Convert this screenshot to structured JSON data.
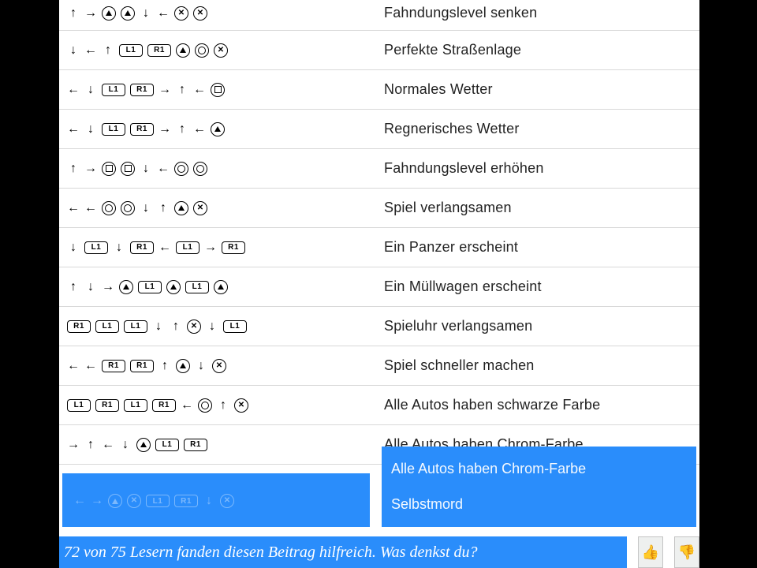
{
  "rows": [
    {
      "code": [
        "up",
        "right",
        "triangle",
        "triangle",
        "down",
        "left",
        "cross",
        "cross"
      ],
      "desc": "Fahndungslevel senken"
    },
    {
      "code": [
        "down",
        "left",
        "up",
        "L1",
        "R1",
        "triangle",
        "circle",
        "cross"
      ],
      "desc": "Perfekte Straßenlage"
    },
    {
      "code": [
        "left",
        "down",
        "L1",
        "R1",
        "right",
        "up",
        "left",
        "square"
      ],
      "desc": "Normales Wetter"
    },
    {
      "code": [
        "left",
        "down",
        "L1",
        "R1",
        "right",
        "up",
        "left",
        "triangle"
      ],
      "desc": "Regnerisches Wetter"
    },
    {
      "code": [
        "up",
        "right",
        "square",
        "square",
        "down",
        "left",
        "circle",
        "circle"
      ],
      "desc": "Fahndungslevel erhöhen"
    },
    {
      "code": [
        "left",
        "left",
        "circle",
        "circle",
        "down",
        "up",
        "triangle",
        "cross"
      ],
      "desc": "Spiel verlangsamen"
    },
    {
      "code": [
        "down",
        "L1",
        "down",
        "R1",
        "left",
        "L1",
        "right",
        "R1"
      ],
      "desc": "Ein Panzer erscheint"
    },
    {
      "code": [
        "up",
        "down",
        "right",
        "triangle",
        "L1",
        "triangle",
        "L1",
        "triangle"
      ],
      "desc": "Ein Müllwagen erscheint"
    },
    {
      "code": [
        "R1",
        "L1",
        "L1",
        "down",
        "up",
        "cross",
        "down",
        "L1"
      ],
      "desc": "Spieluhr verlangsamen"
    },
    {
      "code": [
        "left",
        "left",
        "R1",
        "R1",
        "up",
        "triangle",
        "down",
        "cross"
      ],
      "desc": "Spiel schneller machen"
    },
    {
      "code": [
        "L1",
        "R1",
        "L1",
        "R1",
        "left",
        "circle",
        "up",
        "cross"
      ],
      "desc": "Alle Autos haben schwarze Farbe"
    },
    {
      "code": [
        "right",
        "up",
        "left",
        "down",
        "triangle",
        "L1",
        "R1"
      ],
      "desc": "Alle Autos haben Chrom-Farbe"
    }
  ],
  "highlight_extra_codes": [
    "left",
    "right",
    "triangle",
    "cross",
    "L1",
    "R1",
    "down",
    "cross"
  ],
  "highlight_texts": {
    "chrome": "Alle Autos haben Chrom-Farbe",
    "suicide": "Selbstmord"
  },
  "footer": {
    "message": "72 von 75 Lesern fanden diesen Beitrag hilfreich. Was denkst du?"
  }
}
